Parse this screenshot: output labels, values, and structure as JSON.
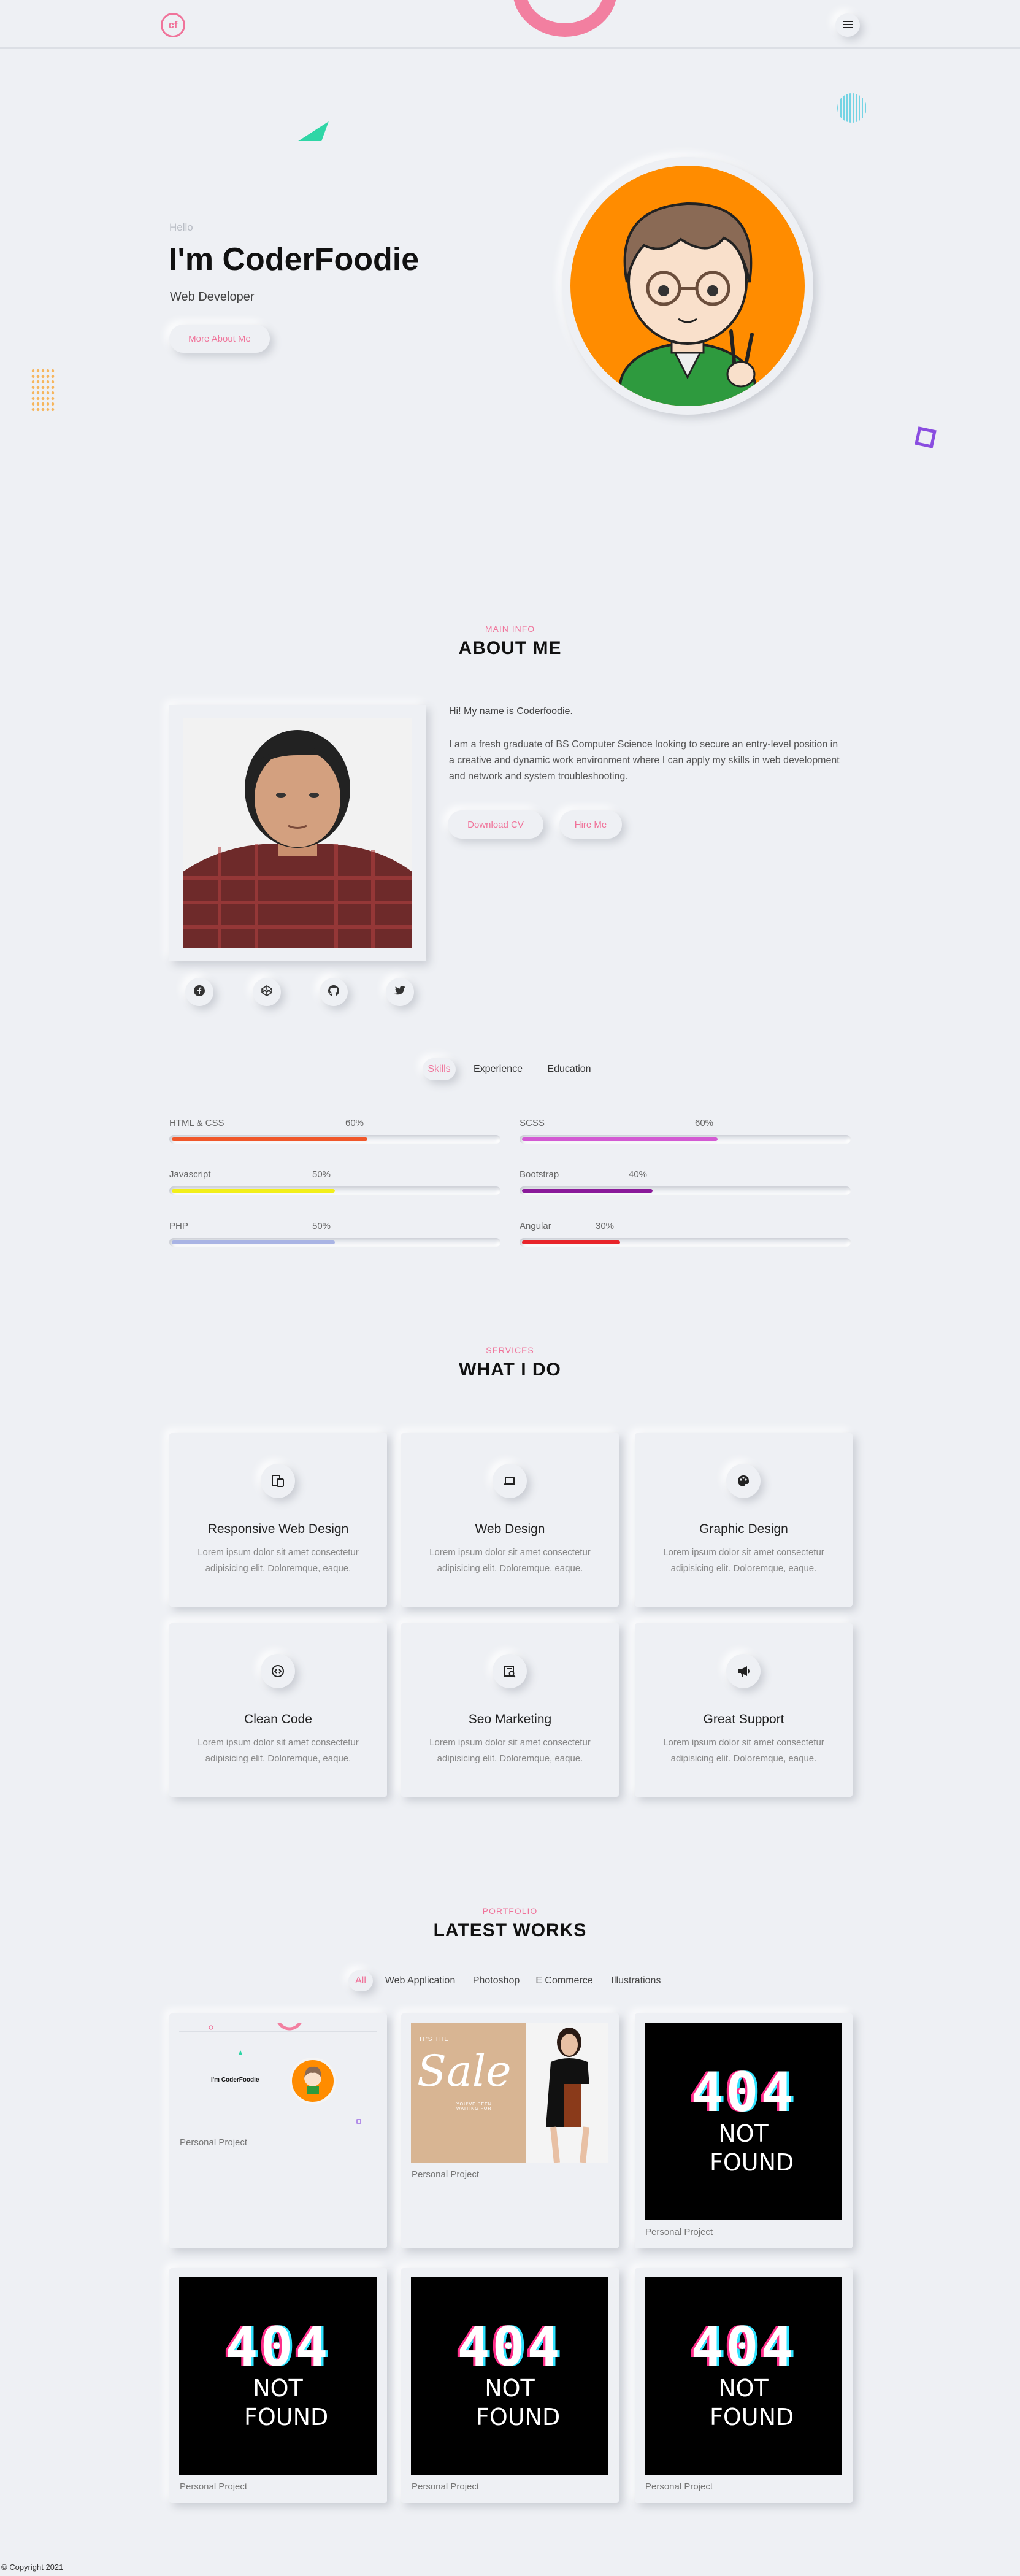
{
  "header": {
    "logo_text": "cf",
    "menu_icon": "hamburger-icon"
  },
  "hero": {
    "greeting": "Hello",
    "name": "I'm CoderFoodie",
    "role": "Web Developer",
    "button": "More About Me"
  },
  "about": {
    "tag": "MAIN INFO",
    "title": "ABOUT ME",
    "greeting": "Hi! My name is Coderfoodie.",
    "body": "I am a fresh graduate of BS Computer Science looking to secure an entry-level position in a creative and dynamic work environment where I can apply my skills in web development and network and system troubleshooting.",
    "buttons": {
      "download": "Download CV",
      "hire": "Hire Me"
    },
    "socials": [
      "facebook-icon",
      "codepen-icon",
      "github-icon",
      "twitter-icon"
    ]
  },
  "tabs": [
    "Skills",
    "Experience",
    "Education"
  ],
  "skills": [
    {
      "name": "HTML & CSS",
      "percent_label": "60%",
      "value": 60,
      "color": "#f0572a"
    },
    {
      "name": "SCSS",
      "percent_label": "60%",
      "value": 60,
      "color": "#d35ad3"
    },
    {
      "name": "Javascript",
      "percent_label": "50%",
      "value": 50,
      "color": "#f2ef1a"
    },
    {
      "name": "Bootstrap",
      "percent_label": "40%",
      "value": 40,
      "color": "#8a1a9a"
    },
    {
      "name": "PHP",
      "percent_label": "50%",
      "value": 50,
      "color": "#a9b4e4"
    },
    {
      "name": "Angular",
      "percent_label": "30%",
      "value": 30,
      "color": "#e8242a"
    }
  ],
  "services": {
    "tag": "SERVICES",
    "title": "WHAT I DO",
    "items": [
      {
        "icon": "devices-icon",
        "title": "Responsive Web Design",
        "text": "Lorem ipsum dolor sit amet consectetur adipisicing elit. Doloremque, eaque."
      },
      {
        "icon": "laptop-icon",
        "title": "Web Design",
        "text": "Lorem ipsum dolor sit amet consectetur adipisicing elit. Doloremque, eaque."
      },
      {
        "icon": "palette-icon",
        "title": "Graphic Design",
        "text": "Lorem ipsum dolor sit amet consectetur adipisicing elit. Doloremque, eaque."
      },
      {
        "icon": "code-icon",
        "title": "Clean Code",
        "text": "Lorem ipsum dolor sit amet consectetur adipisicing elit. Doloremque, eaque."
      },
      {
        "icon": "search-chart-icon",
        "title": "Seo Marketing",
        "text": "Lorem ipsum dolor sit amet consectetur adipisicing elit. Doloremque, eaque."
      },
      {
        "icon": "megaphone-icon",
        "title": "Great Support",
        "text": "Lorem ipsum dolor sit amet consectetur adipisicing elit. Doloremque, eaque."
      }
    ]
  },
  "portfolio": {
    "tag": "PORTFOLIO",
    "title": "LATEST WORKS",
    "filters": [
      "All",
      "Web Application",
      "Photoshop",
      "E Commerce",
      "Illustrations"
    ],
    "items": [
      {
        "caption": "Personal Project",
        "thumb_title": "I'm CoderFoodie"
      },
      {
        "caption": "Personal Project",
        "thumb_small": "IT'S THE",
        "thumb_big": "Sale",
        "thumb_sub": "YOU'VE BEEN WAITING FOR"
      },
      {
        "caption": "Personal Project",
        "big": "404",
        "small": "NOT FOUND"
      },
      {
        "caption": "Personal Project",
        "big": "404",
        "small": "NOT FOUND"
      },
      {
        "caption": "Personal Project",
        "big": "404",
        "small": "NOT FOUND"
      },
      {
        "caption": "Personal Project",
        "big": "404",
        "small": "NOT FOUND"
      }
    ]
  },
  "footer": {
    "copyright": "© Copyright 2021"
  }
}
